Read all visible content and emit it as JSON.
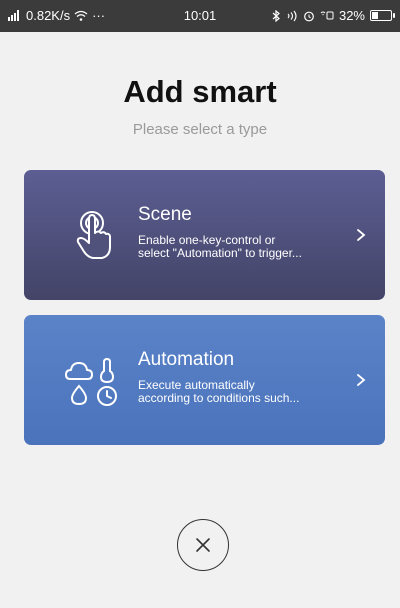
{
  "status_bar": {
    "network_speed": "0.82K/s",
    "extras": "···",
    "time": "10:01",
    "battery_percent": "32%",
    "battery_level": 0.32
  },
  "header": {
    "title": "Add smart",
    "subtitle": "Please select a type"
  },
  "options": [
    {
      "title": "Scene",
      "description_line1": "Enable one-key-control or",
      "description_line2": "select \"Automation\" to trigger...",
      "icon": "tap-hand-icon"
    },
    {
      "title": "Automation",
      "description_line1": "Execute automatically",
      "description_line2": "according to conditions such...",
      "icon": "weather-clock-icon"
    }
  ],
  "close": {
    "icon": "close-icon"
  }
}
